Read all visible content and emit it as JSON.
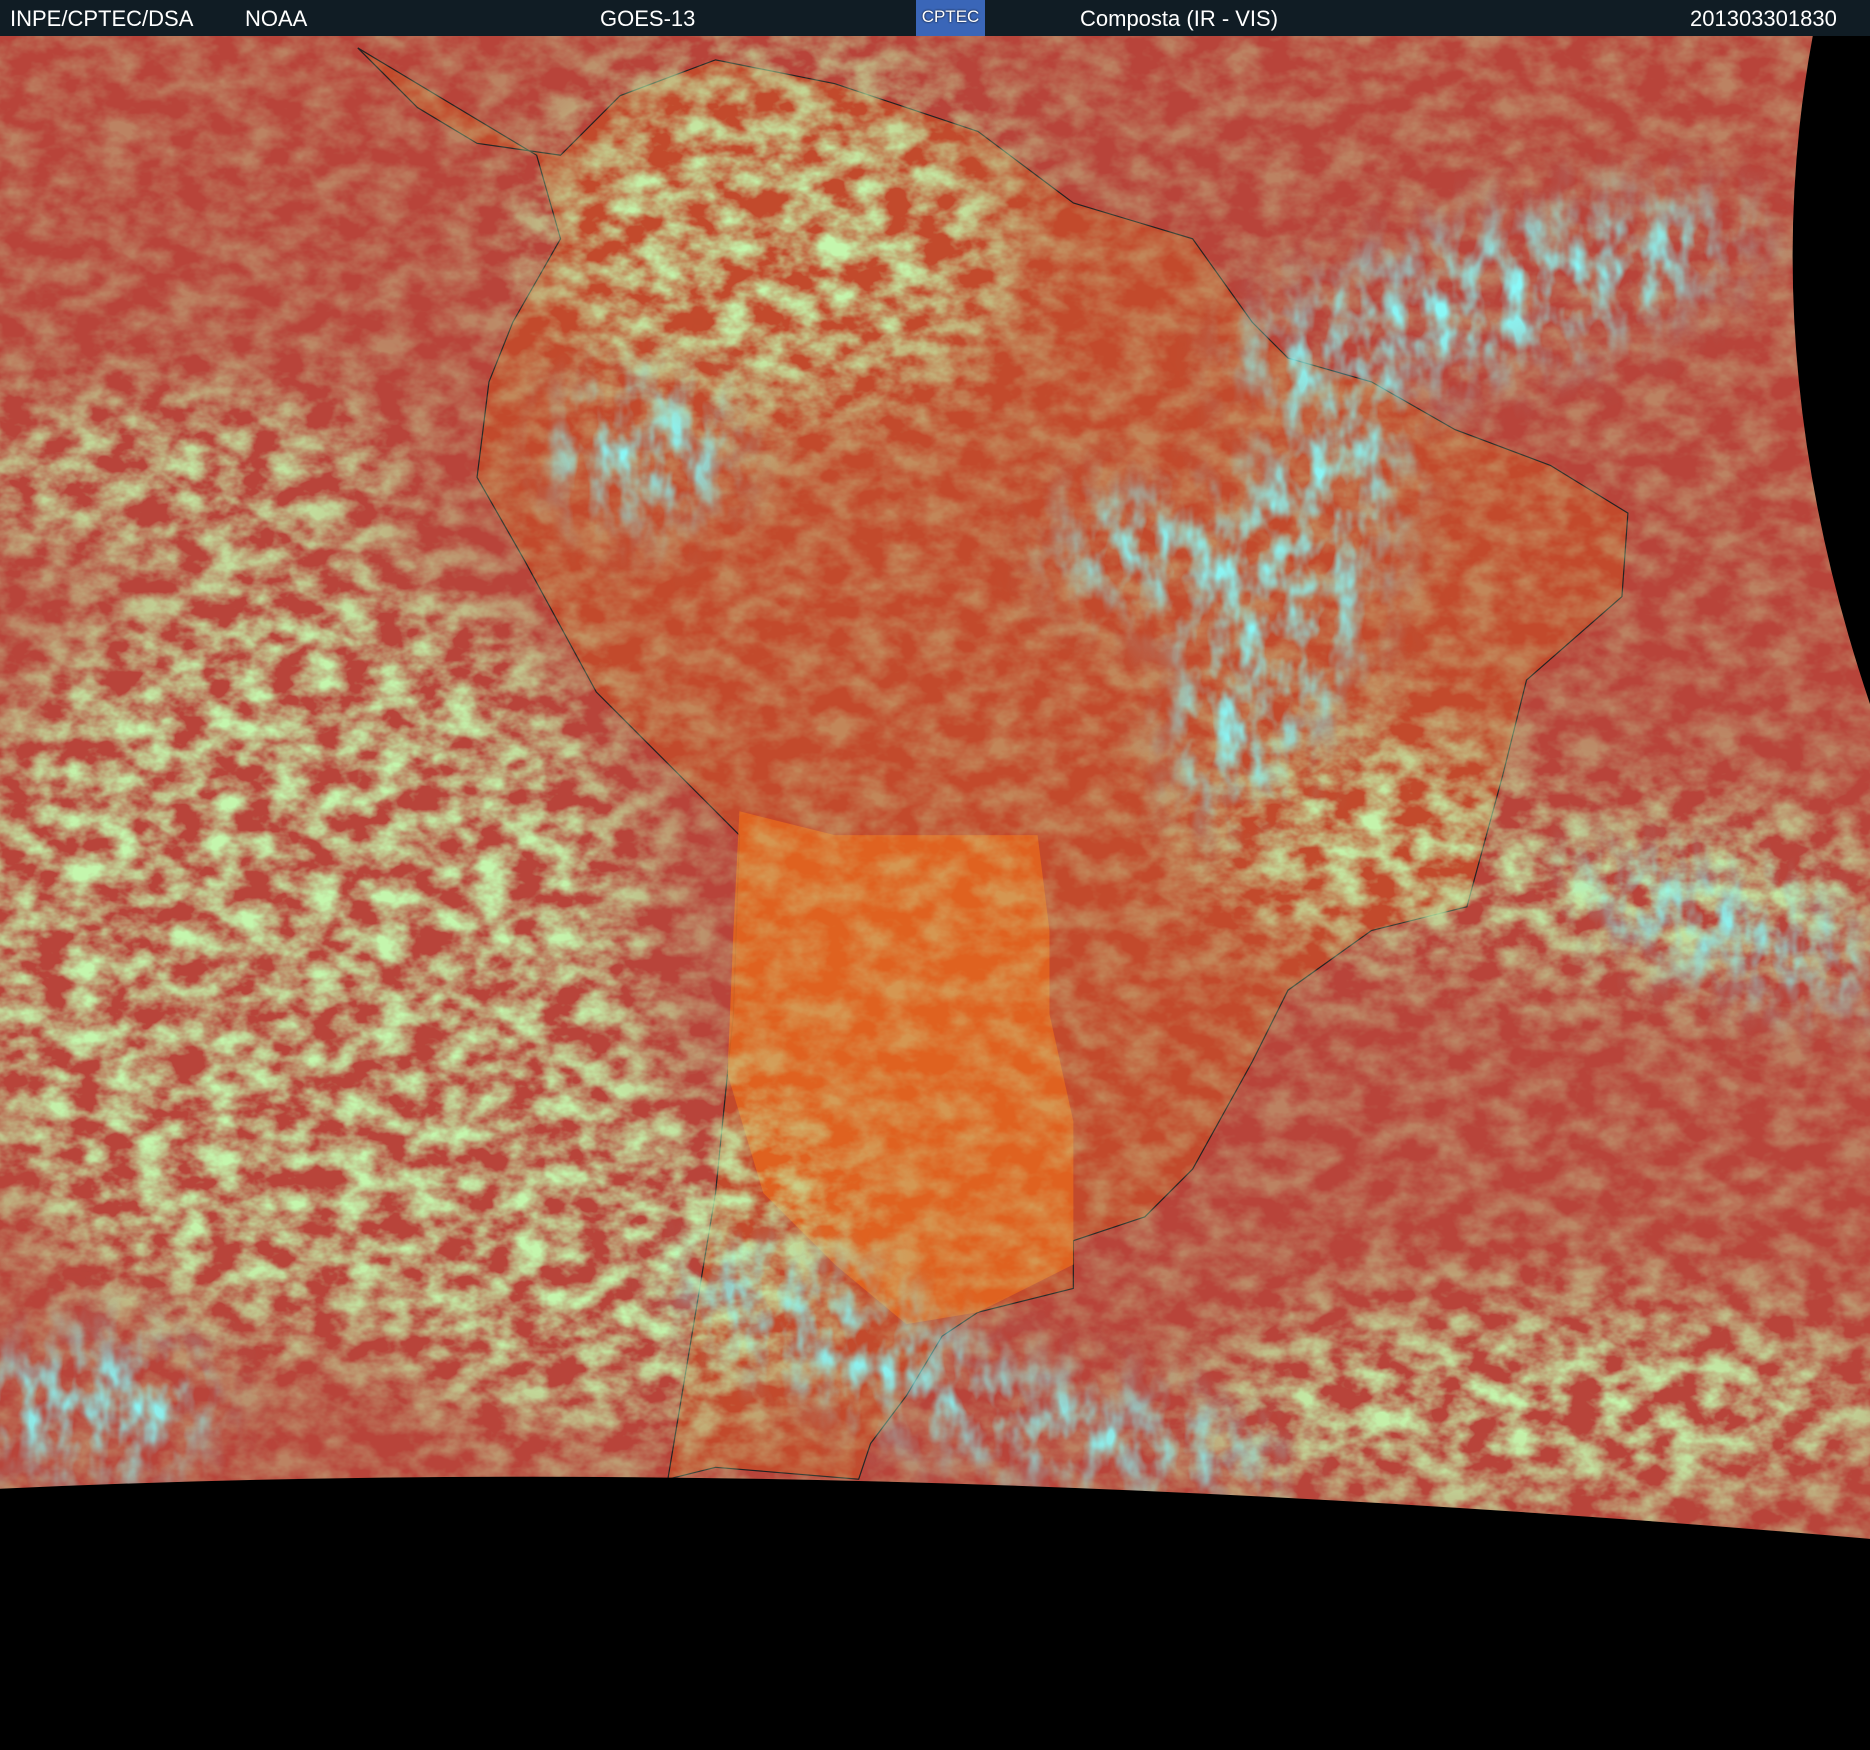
{
  "header": {
    "institution": "INPE/CPTEC/DSA",
    "agency": "NOAA",
    "satellite": "GOES-13",
    "logo_text": "CPTEC",
    "product": "Composta (IR - VIS)",
    "timestamp": "201303301830"
  },
  "colors": {
    "ocean": "#b8443a",
    "land_dry": "#e2651f",
    "cloud_low": "#8ee86a",
    "cloud_high": "#3ff0f0",
    "background": "#000000"
  }
}
